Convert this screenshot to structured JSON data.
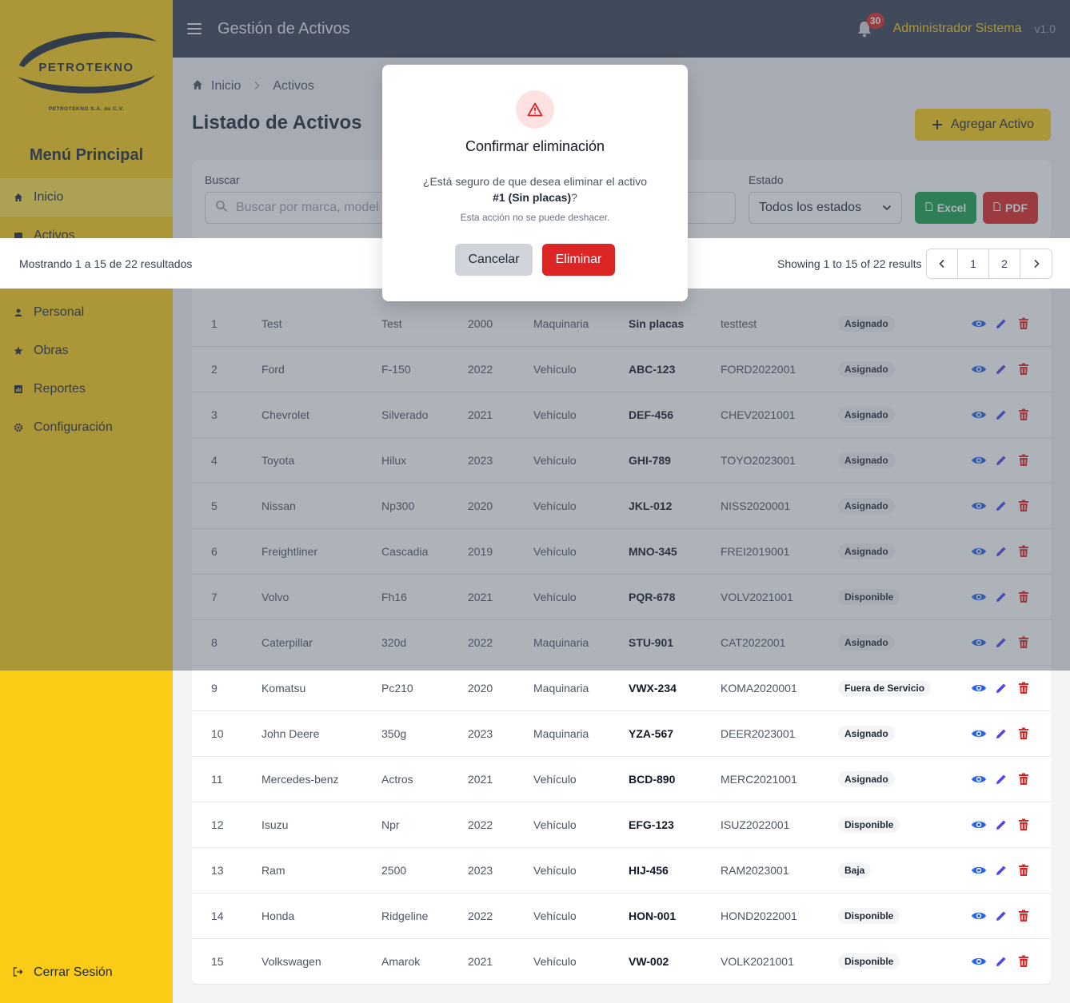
{
  "logo": {
    "name": "PETROTEKNO",
    "sub": "PETROTEKNO S.A. de C.V."
  },
  "sidebar": {
    "menu_title": "Menú Principal",
    "items": [
      {
        "label": "Inicio",
        "icon": "home-icon"
      },
      {
        "label": "Activos",
        "icon": "box-icon"
      },
      {
        "label": "Personal",
        "icon": "user-icon"
      },
      {
        "label": "Obras",
        "icon": "star-icon"
      },
      {
        "label": "Reportes",
        "icon": "chart-icon"
      },
      {
        "label": "Configuración",
        "icon": "gear-icon"
      }
    ],
    "logout": "Cerrar Sesión"
  },
  "header": {
    "title": "Gestión de Activos",
    "notification_count": "30",
    "user": "Administrador Sistema",
    "version": "v1.0"
  },
  "breadcrumb": {
    "home": "Inicio",
    "current": "Activos"
  },
  "page": {
    "title": "Listado de Activos",
    "add_button": "Agregar Activo"
  },
  "filters": {
    "search_label": "Buscar",
    "search_placeholder": "Buscar por marca, model",
    "status_label": "Estado",
    "status_value": "Todos los estados",
    "excel": "Excel",
    "pdf": "PDF"
  },
  "results": {
    "summary_es": "Mostrando 1 a 15 de 22 resultados",
    "summary_en": "Showing 1 to 15 of 22 results",
    "pages": [
      "1",
      "2"
    ]
  },
  "table": {
    "rows": [
      {
        "id": "1",
        "marca": "Test",
        "modelo": "Test",
        "anio": "2000",
        "tipo": "Maquinaria",
        "placas": "Sin placas",
        "serie": "testtest",
        "estado": "Asignado"
      },
      {
        "id": "2",
        "marca": "Ford",
        "modelo": "F-150",
        "anio": "2022",
        "tipo": "Vehículo",
        "placas": "ABC-123",
        "serie": "FORD2022001",
        "estado": "Asignado"
      },
      {
        "id": "3",
        "marca": "Chevrolet",
        "modelo": "Silverado",
        "anio": "2021",
        "tipo": "Vehículo",
        "placas": "DEF-456",
        "serie": "CHEV2021001",
        "estado": "Asignado"
      },
      {
        "id": "4",
        "marca": "Toyota",
        "modelo": "Hilux",
        "anio": "2023",
        "tipo": "Vehículo",
        "placas": "GHI-789",
        "serie": "TOYO2023001",
        "estado": "Asignado"
      },
      {
        "id": "5",
        "marca": "Nissan",
        "modelo": "Np300",
        "anio": "2020",
        "tipo": "Vehículo",
        "placas": "JKL-012",
        "serie": "NISS2020001",
        "estado": "Asignado"
      },
      {
        "id": "6",
        "marca": "Freightliner",
        "modelo": "Cascadia",
        "anio": "2019",
        "tipo": "Vehículo",
        "placas": "MNO-345",
        "serie": "FREI2019001",
        "estado": "Asignado"
      },
      {
        "id": "7",
        "marca": "Volvo",
        "modelo": "Fh16",
        "anio": "2021",
        "tipo": "Vehículo",
        "placas": "PQR-678",
        "serie": "VOLV2021001",
        "estado": "Disponible"
      },
      {
        "id": "8",
        "marca": "Caterpillar",
        "modelo": "320d",
        "anio": "2022",
        "tipo": "Maquinaria",
        "placas": "STU-901",
        "serie": "CAT2022001",
        "estado": "Asignado"
      },
      {
        "id": "9",
        "marca": "Komatsu",
        "modelo": "Pc210",
        "anio": "2020",
        "tipo": "Maquinaria",
        "placas": "VWX-234",
        "serie": "KOMA2020001",
        "estado": "Fuera de Servicio"
      },
      {
        "id": "10",
        "marca": "John Deere",
        "modelo": "350g",
        "anio": "2023",
        "tipo": "Maquinaria",
        "placas": "YZA-567",
        "serie": "DEER2023001",
        "estado": "Asignado"
      },
      {
        "id": "11",
        "marca": "Mercedes-benz",
        "modelo": "Actros",
        "anio": "2021",
        "tipo": "Vehículo",
        "placas": "BCD-890",
        "serie": "MERC2021001",
        "estado": "Asignado"
      },
      {
        "id": "12",
        "marca": "Isuzu",
        "modelo": "Npr",
        "anio": "2022",
        "tipo": "Vehículo",
        "placas": "EFG-123",
        "serie": "ISUZ2022001",
        "estado": "Disponible"
      },
      {
        "id": "13",
        "marca": "Ram",
        "modelo": "2500",
        "anio": "2023",
        "tipo": "Vehículo",
        "placas": "HIJ-456",
        "serie": "RAM2023001",
        "estado": "Baja"
      },
      {
        "id": "14",
        "marca": "Honda",
        "modelo": "Ridgeline",
        "anio": "2022",
        "tipo": "Vehículo",
        "placas": "HON-001",
        "serie": "HOND2022001",
        "estado": "Disponible"
      },
      {
        "id": "15",
        "marca": "Volkswagen",
        "modelo": "Amarok",
        "anio": "2021",
        "tipo": "Vehículo",
        "placas": "VW-002",
        "serie": "VOLK2021001",
        "estado": "Disponible"
      }
    ]
  },
  "modal": {
    "title": "Confirmar eliminación",
    "message_pre": "¿Está seguro de que desea eliminar el activo ",
    "message_bold": "#1 (Sin placas)",
    "message_post": "?",
    "note": "Esta acción no se puede deshacer.",
    "cancel": "Cancelar",
    "confirm": "Eliminar"
  },
  "colors": {
    "brand_yellow": "#facc15",
    "header_bg": "#374151",
    "danger": "#dc2626",
    "success": "#16a34a",
    "view_icon": "#2563eb",
    "edit_icon": "#4f46e5"
  }
}
